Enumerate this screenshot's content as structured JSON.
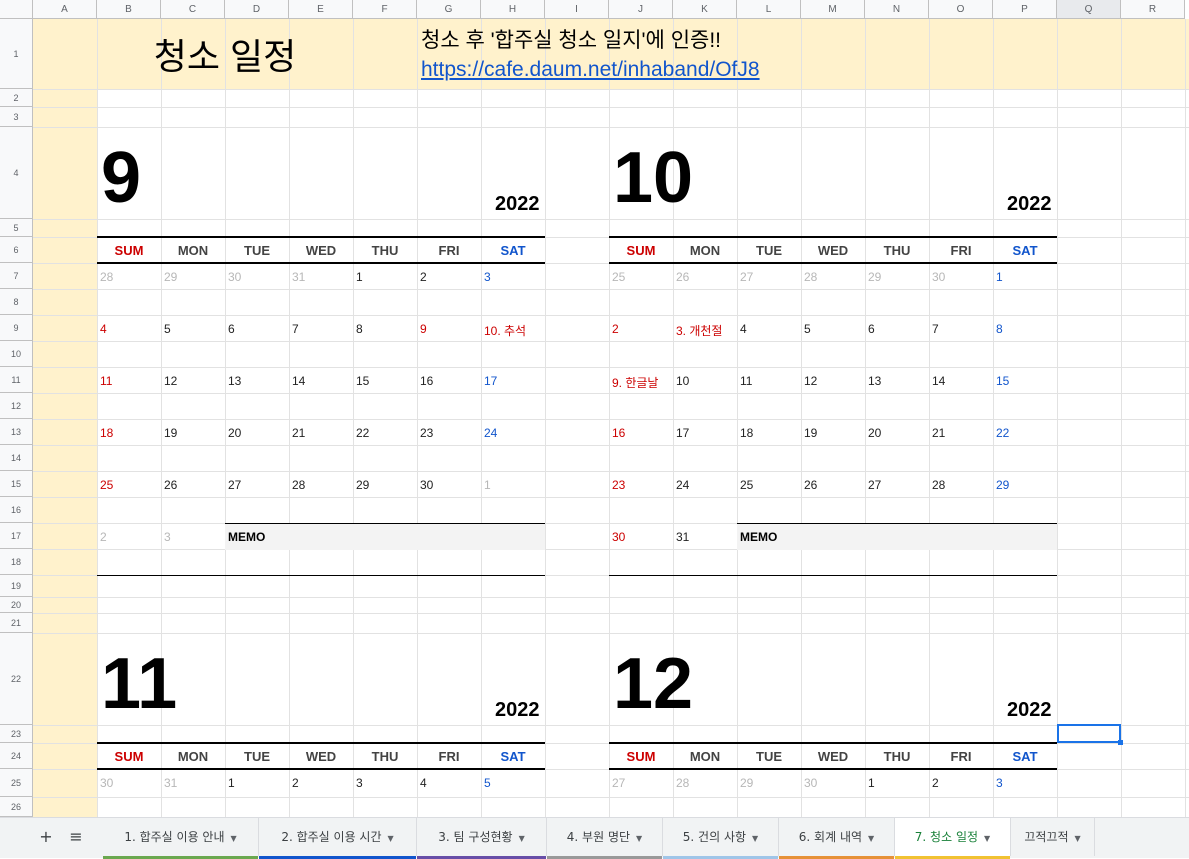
{
  "columns": [
    "A",
    "B",
    "C",
    "D",
    "E",
    "F",
    "G",
    "H",
    "I",
    "J",
    "K",
    "L",
    "M",
    "N",
    "O",
    "P",
    "Q",
    "R"
  ],
  "rows": [
    "1",
    "2",
    "3",
    "4",
    "5",
    "6",
    "7",
    "8",
    "9",
    "10",
    "11",
    "12",
    "13",
    "14",
    "15",
    "16",
    "17",
    "18",
    "19",
    "20",
    "21",
    "22",
    "23",
    "24",
    "25",
    "26"
  ],
  "title": "청소 일정",
  "notice": "청소 후 '합주실 청소 일지'에 인증!!",
  "link": "https://cafe.daum.net/inhaband/OfJ8",
  "weekdays": [
    "SUM",
    "MON",
    "TUE",
    "WED",
    "THU",
    "FRI",
    "SAT"
  ],
  "memo_label": "MEMO",
  "colors": {
    "sunday": "#cc0000",
    "saturday": "#1155cc",
    "muted": "#b7b7b7",
    "header_bg": "#fff2cc",
    "link": "#1155cc"
  },
  "months": [
    {
      "month": "9",
      "year": "2022",
      "weeks": [
        [
          [
            "28",
            "m"
          ],
          [
            "29",
            "m"
          ],
          [
            "30",
            "m"
          ],
          [
            "31",
            "m"
          ],
          [
            "1",
            ""
          ],
          [
            "2",
            ""
          ],
          [
            "3",
            "sat"
          ]
        ],
        [
          [
            "4",
            "sun"
          ],
          [
            "5",
            ""
          ],
          [
            "6",
            ""
          ],
          [
            "7",
            ""
          ],
          [
            "8",
            ""
          ],
          [
            "9",
            "sun"
          ],
          [
            "10. 추석",
            "sun"
          ]
        ],
        [
          [
            "11",
            "sun"
          ],
          [
            "12",
            ""
          ],
          [
            "13",
            ""
          ],
          [
            "14",
            ""
          ],
          [
            "15",
            ""
          ],
          [
            "16",
            ""
          ],
          [
            "17",
            "sat"
          ]
        ],
        [
          [
            "18",
            "sun"
          ],
          [
            "19",
            ""
          ],
          [
            "20",
            ""
          ],
          [
            "21",
            ""
          ],
          [
            "22",
            ""
          ],
          [
            "23",
            ""
          ],
          [
            "24",
            "sat"
          ]
        ],
        [
          [
            "25",
            "sun"
          ],
          [
            "26",
            ""
          ],
          [
            "27",
            ""
          ],
          [
            "28",
            ""
          ],
          [
            "29",
            ""
          ],
          [
            "30",
            ""
          ],
          [
            "1",
            "m"
          ]
        ],
        [
          [
            "2",
            "m"
          ],
          [
            "3",
            "m"
          ]
        ]
      ]
    },
    {
      "month": "10",
      "year": "2022",
      "weeks": [
        [
          [
            "25",
            "m"
          ],
          [
            "26",
            "m"
          ],
          [
            "27",
            "m"
          ],
          [
            "28",
            "m"
          ],
          [
            "29",
            "m"
          ],
          [
            "30",
            "m"
          ],
          [
            "1",
            "sat"
          ]
        ],
        [
          [
            "2",
            "sun"
          ],
          [
            "3. 개천절",
            "sun"
          ],
          [
            "4",
            ""
          ],
          [
            "5",
            ""
          ],
          [
            "6",
            ""
          ],
          [
            "7",
            ""
          ],
          [
            "8",
            "sat"
          ]
        ],
        [
          [
            "9. 한글날",
            "sun"
          ],
          [
            "10",
            ""
          ],
          [
            "11",
            ""
          ],
          [
            "12",
            ""
          ],
          [
            "13",
            ""
          ],
          [
            "14",
            ""
          ],
          [
            "15",
            "sat"
          ]
        ],
        [
          [
            "16",
            "sun"
          ],
          [
            "17",
            ""
          ],
          [
            "18",
            ""
          ],
          [
            "19",
            ""
          ],
          [
            "20",
            ""
          ],
          [
            "21",
            ""
          ],
          [
            "22",
            "sat"
          ]
        ],
        [
          [
            "23",
            "sun"
          ],
          [
            "24",
            ""
          ],
          [
            "25",
            ""
          ],
          [
            "26",
            ""
          ],
          [
            "27",
            ""
          ],
          [
            "28",
            ""
          ],
          [
            "29",
            "sat"
          ]
        ],
        [
          [
            "30",
            "sun"
          ],
          [
            "31",
            ""
          ]
        ]
      ]
    },
    {
      "month": "11",
      "year": "2022",
      "weeks": [
        [
          [
            "30",
            "m"
          ],
          [
            "31",
            "m"
          ],
          [
            "1",
            ""
          ],
          [
            "2",
            ""
          ],
          [
            "3",
            ""
          ],
          [
            "4",
            ""
          ],
          [
            "5",
            "sat"
          ]
        ]
      ]
    },
    {
      "month": "12",
      "year": "2022",
      "weeks": [
        [
          [
            "27",
            "m"
          ],
          [
            "28",
            "m"
          ],
          [
            "29",
            "m"
          ],
          [
            "30",
            "m"
          ],
          [
            "1",
            ""
          ],
          [
            "2",
            ""
          ],
          [
            "3",
            "sat"
          ]
        ]
      ]
    }
  ],
  "tabs": [
    {
      "label": "1. 합주실 이용 안내",
      "color": "#6aa84f",
      "active": false
    },
    {
      "label": "2. 합주실 이용 시간",
      "color": "#1155cc",
      "active": false
    },
    {
      "label": "3. 팀 구성현황",
      "color": "#674ea7",
      "active": false
    },
    {
      "label": "4. 부원 명단",
      "color": "#999999",
      "active": false
    },
    {
      "label": "5. 건의 사항",
      "color": "#9fc5e8",
      "active": false
    },
    {
      "label": "6. 회계 내역",
      "color": "#e69138",
      "active": false
    },
    {
      "label": "7. 청소 일정",
      "color": "#f1c232",
      "active": true
    },
    {
      "label": "끄적끄적",
      "color": "",
      "active": false
    }
  ],
  "add_sheet_icon": "+",
  "all_sheets_icon": "≡"
}
